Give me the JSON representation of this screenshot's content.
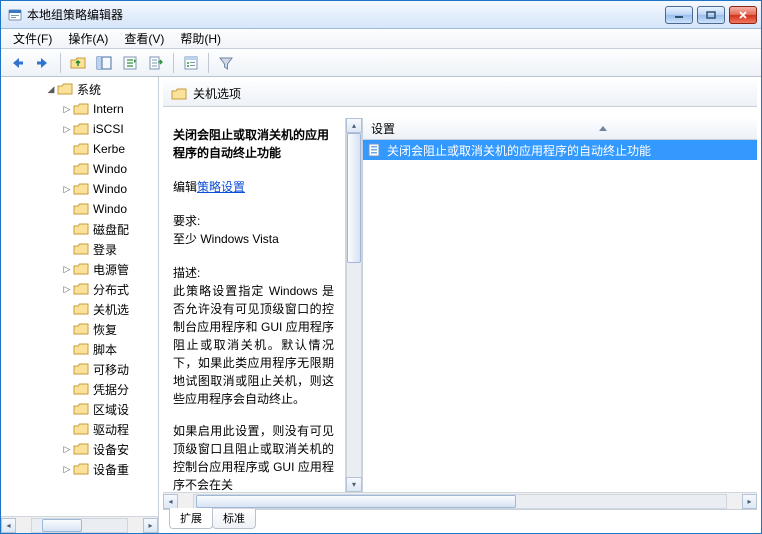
{
  "window": {
    "title": "本地组策略编辑器"
  },
  "menu": {
    "file": "文件(F)",
    "action": "操作(A)",
    "view": "查看(V)",
    "help": "帮助(H)"
  },
  "toolbar_icons": {
    "back": "back-arrow-icon",
    "forward": "forward-arrow-icon",
    "up": "folder-up-icon",
    "panes": "show-hide-tree-icon",
    "refresh": "refresh-list-icon",
    "export": "export-list-icon",
    "props": "properties-icon",
    "filter": "filter-icon"
  },
  "tree": {
    "root_label": "系统",
    "items": [
      {
        "label": "Intern",
        "depth": 1,
        "expander": "▷"
      },
      {
        "label": "iSCSI",
        "depth": 1,
        "expander": "▷"
      },
      {
        "label": "Kerbe",
        "depth": 1,
        "expander": ""
      },
      {
        "label": "Windo",
        "depth": 1,
        "expander": ""
      },
      {
        "label": "Windo",
        "depth": 1,
        "expander": "▷"
      },
      {
        "label": "Windo",
        "depth": 1,
        "expander": ""
      },
      {
        "label": "磁盘配",
        "depth": 1,
        "expander": ""
      },
      {
        "label": "登录",
        "depth": 1,
        "expander": ""
      },
      {
        "label": "电源管",
        "depth": 1,
        "expander": "▷"
      },
      {
        "label": "分布式",
        "depth": 1,
        "expander": "▷"
      },
      {
        "label": "关机选",
        "depth": 1,
        "expander": ""
      },
      {
        "label": "恢复",
        "depth": 1,
        "expander": ""
      },
      {
        "label": "脚本",
        "depth": 1,
        "expander": ""
      },
      {
        "label": "可移动",
        "depth": 1,
        "expander": ""
      },
      {
        "label": "凭据分",
        "depth": 1,
        "expander": ""
      },
      {
        "label": "区域设",
        "depth": 1,
        "expander": ""
      },
      {
        "label": "驱动程",
        "depth": 1,
        "expander": ""
      },
      {
        "label": "设备安",
        "depth": 1,
        "expander": "▷"
      },
      {
        "label": "设备重",
        "depth": 1,
        "expander": "▷"
      }
    ]
  },
  "breadcrumb": {
    "label": "关机选项"
  },
  "description": {
    "title": "关闭会阻止或取消关机的应用程序的自动终止功能",
    "edit_prefix": "编辑",
    "edit_link": "策略设置",
    "req_label": "要求:",
    "req_value": "至少 Windows Vista",
    "desc_label": "描述:",
    "desc_p1": "此策略设置指定 Windows 是否允许没有可见顶级窗口的控制台应用程序和 GUI 应用程序阻止或取消关机。默认情况下，如果此类应用程序无限期地试图取消或阻止关机，则这些应用程序会自动终止。",
    "desc_p2_a": "如果启用此设置，则没有可见顶级窗口且阻止或取消关机的控制台应用程序或 GUI 应用程序不会在关"
  },
  "list": {
    "header": "设置",
    "rows": [
      {
        "label": "关闭会阻止或取消关机的应用程序的自动终止功能",
        "selected": true
      }
    ]
  },
  "tabs": {
    "extended": "扩展",
    "standard": "标准"
  }
}
